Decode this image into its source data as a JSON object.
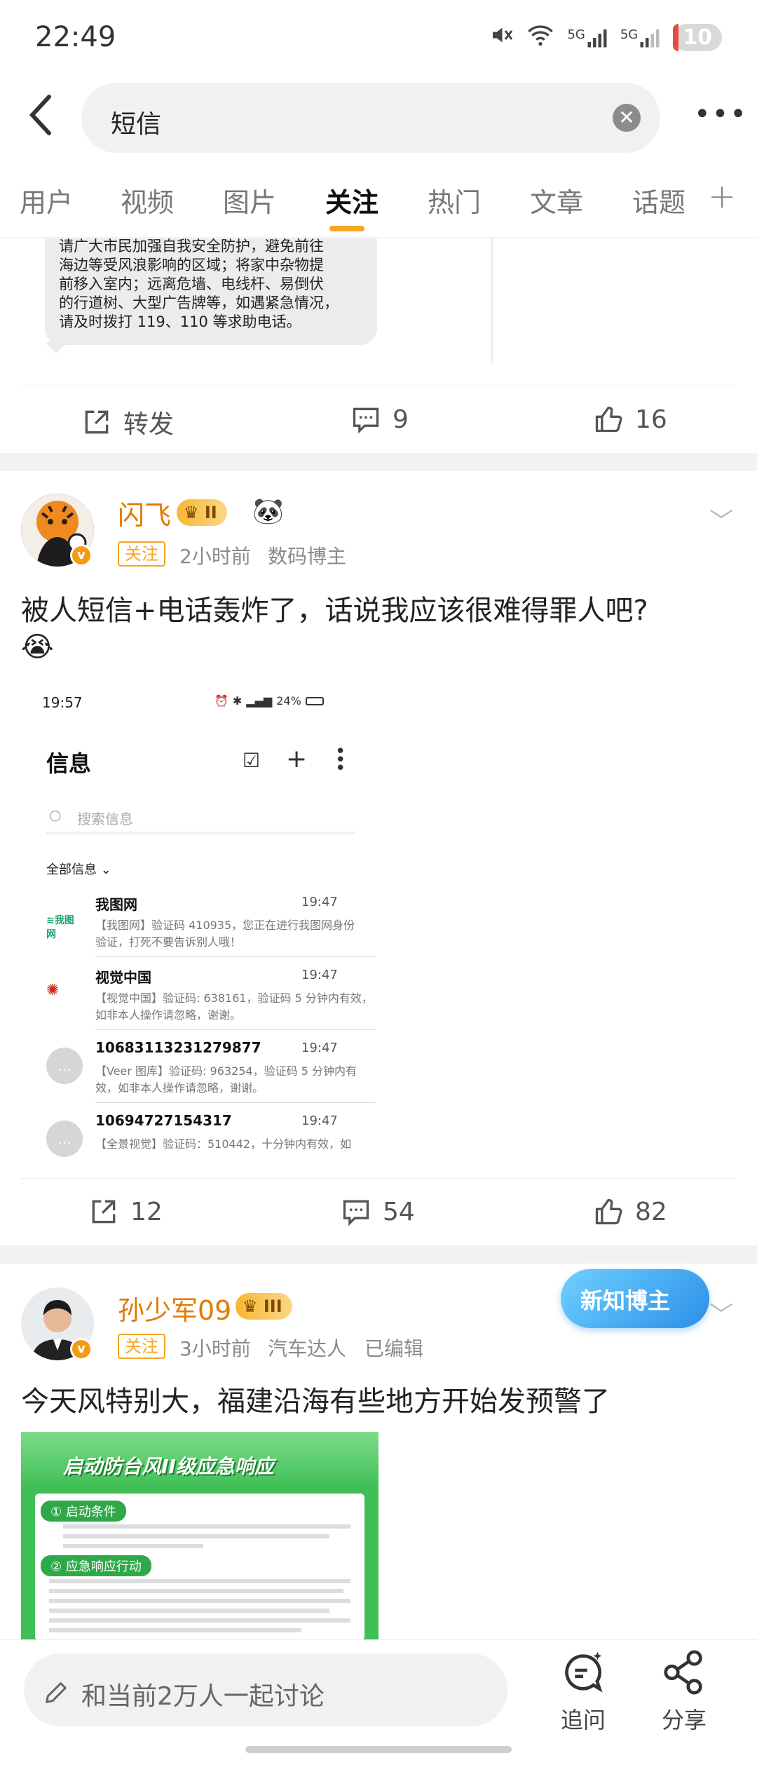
{
  "status_bar": {
    "time": "22:49",
    "battery": "10",
    "net_5g_a": "5G",
    "net_5g_b": "5G"
  },
  "search": {
    "query": "短信"
  },
  "tabs": [
    {
      "label": "用户"
    },
    {
      "label": "视频"
    },
    {
      "label": "图片"
    },
    {
      "label": "关注"
    },
    {
      "label": "热门"
    },
    {
      "label": "文章"
    },
    {
      "label": "话题"
    }
  ],
  "post0": {
    "bubble_lines": [
      "请广大市民加强自我安全防护，避免前往",
      "海边等受风浪影响的区域；将家中杂物提",
      "前移入室内；远离危墙、电线杆、易倒伏",
      "的行道树、大型广告牌等，如遇紧急情况，",
      "请及时拨打 119、110 等求助电话。"
    ],
    "repost_label": "转发",
    "comments": "9",
    "likes": "16"
  },
  "post1": {
    "username": "闪飞",
    "level": "II",
    "follow_label": "关注",
    "time": "2小时前",
    "tag": "数码博主",
    "text": "被人短信+电话轰炸了，话说我应该很难得罪人吧?",
    "emoji": "😭",
    "reposts": "12",
    "comments": "54",
    "likes": "82",
    "screenshot": {
      "time": "19:57",
      "battery": "24%",
      "title": "信息",
      "search_placeholder": "搜索信息",
      "filter": "全部信息",
      "messages": [
        {
          "sender": "我图网",
          "time": "19:47",
          "line1": "【我图网】验证码 410935，您正在进行我图网身份",
          "line2": "验证，打死不要告诉别人哦！"
        },
        {
          "sender": "视觉中国",
          "time": "19:47",
          "line1": "【视觉中国】验证码: 638161，验证码 5 分钟内有效，",
          "line2": "如非本人操作请忽略，谢谢。"
        },
        {
          "sender": "10683113231279877",
          "time": "19:47",
          "line1": "【Veer 图库】验证码: 963254，验证码 5 分钟内有",
          "line2": "效，如非本人操作请忽略，谢谢。"
        },
        {
          "sender": "10694727154317",
          "time": "19:47",
          "line1": "【全景视觉】验证码：510442，十分钟内有效，如",
          "line2": ""
        }
      ]
    }
  },
  "post2": {
    "username": "孙少军09",
    "level": "III",
    "follow_label": "关注",
    "time": "3小时前",
    "tag": "汽车达人",
    "edited": "已编辑",
    "badge": "新知博主",
    "text": "今天风特别大，福建沿海有些地方开始发预警了",
    "poster": {
      "title": "启动防台风II级应急响应",
      "section1": "启动条件",
      "section2": "应急响应行动"
    }
  },
  "bottom": {
    "comment_placeholder": "和当前2万人一起讨论",
    "follow_up": "追问",
    "share": "分享"
  }
}
